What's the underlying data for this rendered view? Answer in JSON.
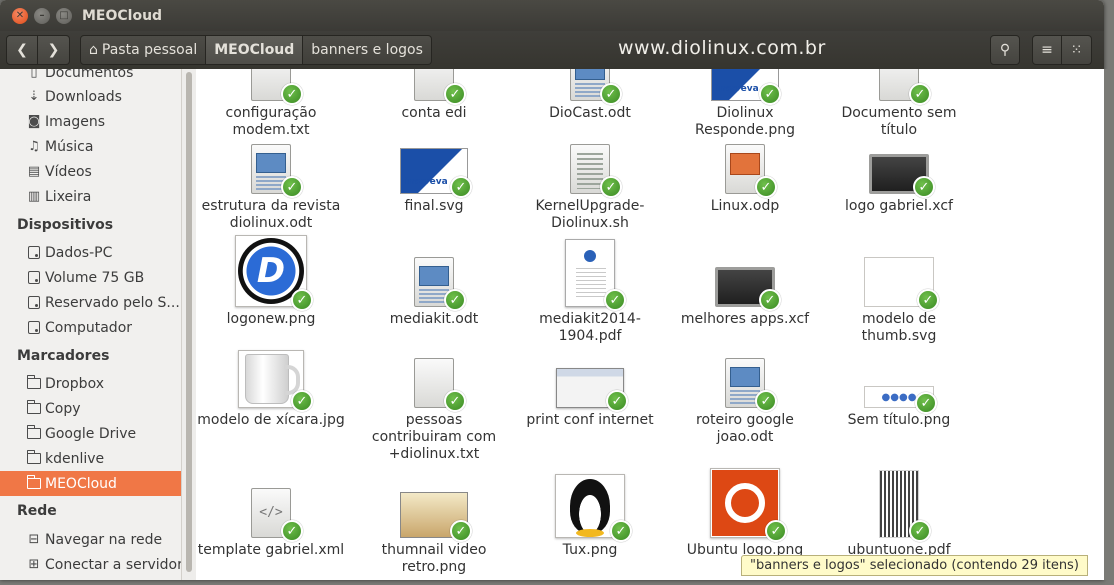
{
  "window": {
    "title": "MEOCloud"
  },
  "toolbar": {
    "back_icon": "chevron-left",
    "forward_icon": "chevron-right",
    "breadcrumbs": [
      "Pasta pessoal",
      "MEOCloud",
      "banners e logos"
    ],
    "watermark": "www.diolinux.com.br"
  },
  "sidebar": {
    "places": [
      {
        "label": "Documentos",
        "icon": "document-icon"
      },
      {
        "label": "Downloads",
        "icon": "download-icon"
      },
      {
        "label": "Imagens",
        "icon": "camera-icon"
      },
      {
        "label": "Música",
        "icon": "music-icon"
      },
      {
        "label": "Vídeos",
        "icon": "film-icon"
      },
      {
        "label": "Lixeira",
        "icon": "trash-icon"
      }
    ],
    "devices_header": "Dispositivos",
    "devices": [
      {
        "label": "Dados-PC"
      },
      {
        "label": "Volume 75 GB"
      },
      {
        "label": "Reservado pelo S..."
      },
      {
        "label": "Computador"
      }
    ],
    "bookmarks_header": "Marcadores",
    "bookmarks": [
      {
        "label": "Dropbox"
      },
      {
        "label": "Copy"
      },
      {
        "label": "Google Drive"
      },
      {
        "label": "kdenlive"
      },
      {
        "label": "MEOCloud",
        "selected": true
      }
    ],
    "network_header": "Rede",
    "network": [
      {
        "label": "Navegar na rede",
        "icon": "network-icon"
      },
      {
        "label": "Conectar a servidor",
        "icon": "server-icon"
      }
    ]
  },
  "files": [
    {
      "name": "configuração modem.txt",
      "type": "txt"
    },
    {
      "name": "conta edi",
      "type": "txt"
    },
    {
      "name": "DioCast.odt",
      "type": "odt"
    },
    {
      "name": "Diolinux Responde.png",
      "type": "png"
    },
    {
      "name": "Documento sem título",
      "type": "txt"
    },
    {
      "name": "estrutura da revista diolinux.odt",
      "type": "odt"
    },
    {
      "name": "final.svg",
      "type": "svg"
    },
    {
      "name": "KernelUpgrade-Diolinux.sh",
      "type": "sh"
    },
    {
      "name": "Linux.odp",
      "type": "odp"
    },
    {
      "name": "logo gabriel.xcf",
      "type": "xcf"
    },
    {
      "name": "logonew.png",
      "type": "png"
    },
    {
      "name": "mediakit.odt",
      "type": "odt"
    },
    {
      "name": "mediakit2014-1904.pdf",
      "type": "pdf"
    },
    {
      "name": "melhores apps.xcf",
      "type": "xcf"
    },
    {
      "name": "modelo de thumb.svg",
      "type": "svg"
    },
    {
      "name": "modelo de xícara.jpg",
      "type": "jpg"
    },
    {
      "name": "pessoas contribuiram com +diolinux.txt",
      "type": "txt"
    },
    {
      "name": "print conf internet",
      "type": "png"
    },
    {
      "name": "roteiro google joao.odt",
      "type": "odt"
    },
    {
      "name": "Sem título.png",
      "type": "png"
    },
    {
      "name": "template gabriel.xml",
      "type": "xml"
    },
    {
      "name": "thumnail video retro.png",
      "type": "png"
    },
    {
      "name": "Tux.png",
      "type": "png"
    },
    {
      "name": "Ubuntu logo.png",
      "type": "png"
    },
    {
      "name": "ubuntuone.pdf",
      "type": "pdf"
    }
  ],
  "statusbar": {
    "text": "\"banners e logos\" selecionado  (contendo 29 itens)"
  },
  "colors": {
    "accent": "#f07746",
    "sync_check": "#4aa12c",
    "titlebar": "#3c3b37"
  }
}
